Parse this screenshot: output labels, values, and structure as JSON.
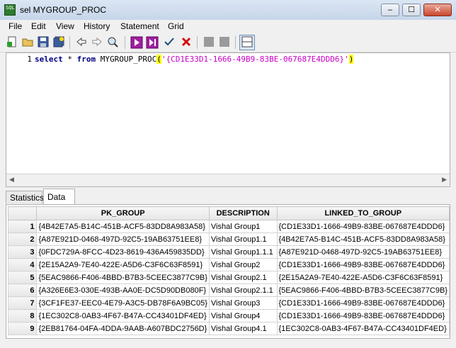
{
  "window": {
    "title": "sel MYGROUP_PROC",
    "icon_text": "SQL",
    "minimize": "–",
    "maximize": "☐",
    "close": "✕"
  },
  "menu": [
    "File",
    "Edit",
    "View",
    "History",
    "Statement",
    "Grid"
  ],
  "toolbar": {
    "icons": [
      "new-icon",
      "open-icon",
      "save-icon",
      "save-all-icon",
      "back-icon",
      "forward-icon",
      "find-icon",
      "execute-icon",
      "execute-script-icon",
      "commit-icon",
      "cancel-icon",
      "disabled-grid-icon-1",
      "disabled-grid-icon-2",
      "layout-icon"
    ]
  },
  "editor": {
    "line_number": "1",
    "kw1": "select",
    "mid": " * ",
    "kw2": "from",
    "proc": " MYGROUP_PROC",
    "open_paren": "(",
    "arg": "'{CD1E33D1-1666-49B9-83BE-067687E4DDD6}'",
    "close_paren": ")"
  },
  "tabs": [
    "Statistics",
    "Data"
  ],
  "grid": {
    "headers": [
      "PK_GROUP",
      "DESCRIPTION",
      "LINKED_TO_GROUP"
    ],
    "rows": [
      [
        "1",
        "{4B42E7A5-B14C-451B-ACF5-83DD8A983A58}",
        "Vishal Group1",
        "{CD1E33D1-1666-49B9-83BE-067687E4DDD6}"
      ],
      [
        "2",
        "{A87E921D-0468-497D-92C5-19AB63751EE8}",
        "Vishal Group1.1",
        "{4B42E7A5-B14C-451B-ACF5-83DD8A983A58}"
      ],
      [
        "3",
        "{0FDC729A-8FCC-4D23-8619-436A459835DD}",
        "Vishal Group1.1.1",
        "{A87E921D-0468-497D-92C5-19AB63751EE8}"
      ],
      [
        "4",
        "{2E15A2A9-7E40-422E-A5D6-C3F6C63F8591}",
        "Vishal Group2",
        "{CD1E33D1-1666-49B9-83BE-067687E4DDD6}"
      ],
      [
        "5",
        "{5EAC9866-F406-4BBD-B7B3-5CEEC3877C9B}",
        "Vishal Group2.1",
        "{2E15A2A9-7E40-422E-A5D6-C3F6C63F8591}"
      ],
      [
        "6",
        "{A326E6E3-030E-493B-AA0E-DC5D90DB080F}",
        "Vishal Group2.1.1",
        "{5EAC9866-F406-4BBD-B7B3-5CEEC3877C9B}"
      ],
      [
        "7",
        "{3CF1FE37-EEC0-4E79-A3C5-DB78F6A9BC05}",
        "Vishal Group3",
        "{CD1E33D1-1666-49B9-83BE-067687E4DDD6}"
      ],
      [
        "8",
        "{1EC302C8-0AB3-4F67-B47A-CC43401DF4ED}",
        "Vishal Group4",
        "{CD1E33D1-1666-49B9-83BE-067687E4DDD6}"
      ],
      [
        "9",
        "{2EB81764-04FA-4DDA-9AAB-A607BDC2756D}",
        "Vishal Group4.1",
        "{1EC302C8-0AB3-4F67-B47A-CC43401DF4ED}"
      ]
    ]
  }
}
